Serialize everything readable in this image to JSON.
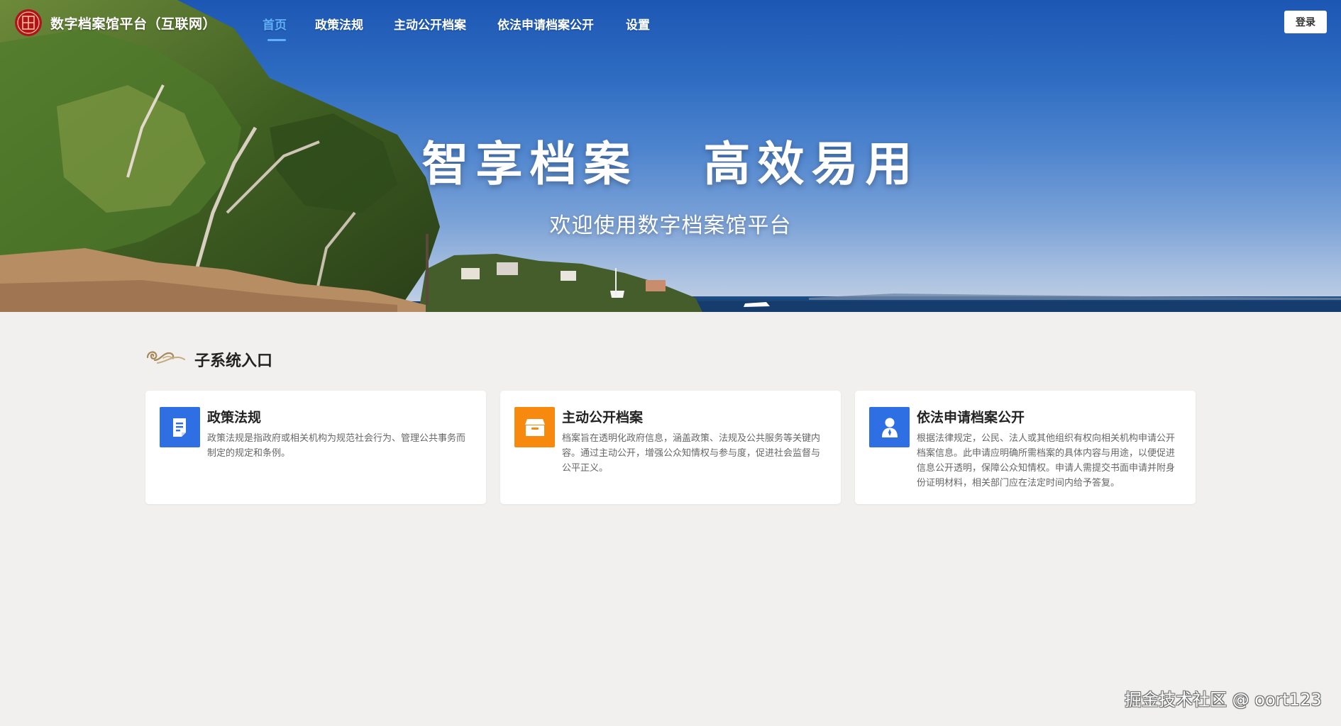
{
  "header": {
    "site_title": "数字档案馆平台（互联网）",
    "nav": [
      {
        "label": "首页",
        "active": true
      },
      {
        "label": "政策法规",
        "active": false
      },
      {
        "label": "主动公开档案",
        "active": false
      },
      {
        "label": "依法申请档案公开",
        "active": false
      },
      {
        "label": "设置",
        "active": false
      }
    ],
    "login_label": "登录"
  },
  "hero": {
    "title": "智享档案 高效易用",
    "subtitle": "欢迎使用数字档案馆平台"
  },
  "section": {
    "title": "子系统入口"
  },
  "cards": [
    {
      "title": "政策法规",
      "description": "政策法规是指政府或相关机构为规范社会行为、管理公共事务而制定的规定和条例。",
      "icon": "document-icon",
      "color": "#2f6fe4"
    },
    {
      "title": "主动公开档案",
      "description": "档案旨在透明化政府信息，涵盖政策、法规及公共服务等关键内容。通过主动公开，增强公众知情权与参与度，促进社会监督与公平正义。",
      "icon": "box-icon",
      "color": "#f7890f"
    },
    {
      "title": "依法申请档案公开",
      "description": "根据法律规定，公民、法人或其他组织有权向相关机构申请公开档案信息。此申请应明确所需档案的具体内容与用途，以便促进信息公开透明，保障公众知情权。申请人需提交书面申请并附身份证明材料，相关部门应在法定时间内给予答复。",
      "icon": "user-icon",
      "color": "#2f6fe4"
    }
  ],
  "watermark": "掘金技术社区 @ oort123",
  "colors": {
    "nav_active": "#5fb0ff",
    "page_background": "#f1f0ee"
  }
}
